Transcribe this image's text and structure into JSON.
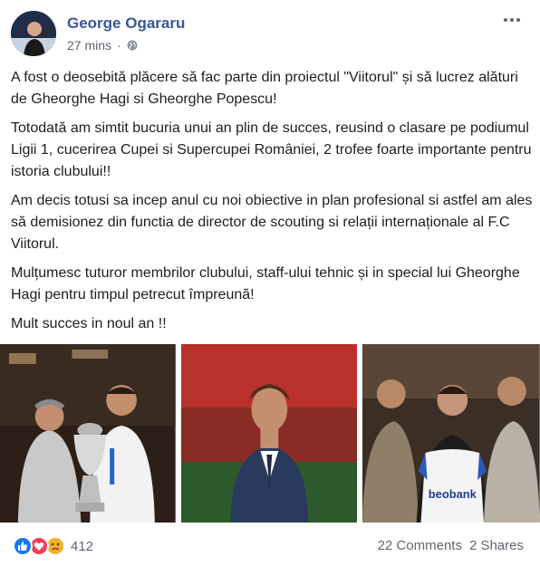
{
  "post": {
    "author": "George Ogararu",
    "time": "27 mins",
    "privacy_icon": "globe-icon",
    "more_icon": "ellipsis-icon",
    "paragraphs": [
      "A fost o deosebită plăcere să fac parte din proiectul \"Viitorul\" și să lucrez alături de Gheorghe Hagi si Gheorghe Popescu!",
      "Totodată am simtit bucuria unui an plin de succes, reusind o clasare pe podiumul Ligii 1, cucerirea Cupei si Supercupei României, 2 trofee foarte importante pentru istoria clubului!!",
      "Am decis totusi sa incep anul cu noi obiective in plan profesional si astfel am ales să demisionez din functia de director de scouting si relații internaționale al F.C Viitorul.",
      "Mulțumesc tuturor membrilor clubului, staff-ului tehnic și in special lui Gheorghe Hagi pentru timpul petrecut împreună!",
      "Mult succes in noul an !!"
    ],
    "photos": [
      {
        "name": "photo-trophy"
      },
      {
        "name": "photo-stadium"
      },
      {
        "name": "photo-jersey",
        "jersey_text": "beobank"
      }
    ],
    "reactions": {
      "icons": [
        "like-icon",
        "love-icon",
        "sad-icon"
      ],
      "count": "412"
    },
    "comments": "22 Comments",
    "shares": "2 Shares"
  }
}
